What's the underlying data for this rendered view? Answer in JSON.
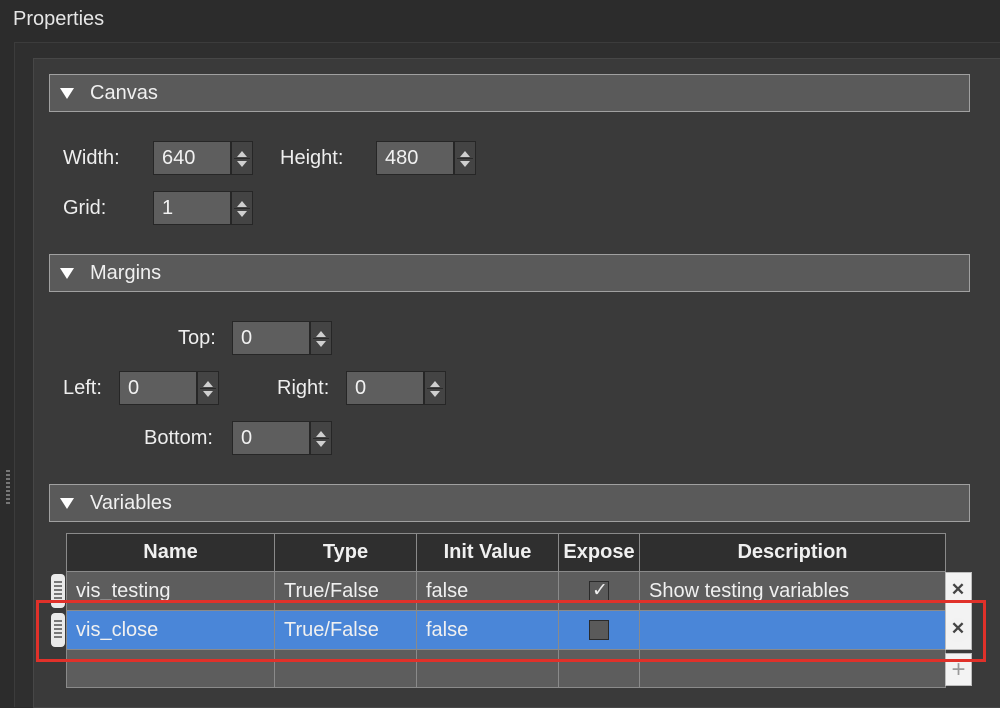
{
  "panel": {
    "title": "Properties"
  },
  "canvas": {
    "header": "Canvas",
    "width_label": "Width:",
    "width_value": "640",
    "height_label": "Height:",
    "height_value": "480",
    "grid_label": "Grid:",
    "grid_value": "1"
  },
  "margins": {
    "header": "Margins",
    "top_label": "Top:",
    "top_value": "0",
    "left_label": "Left:",
    "left_value": "0",
    "right_label": "Right:",
    "right_value": "0",
    "bottom_label": "Bottom:",
    "bottom_value": "0"
  },
  "variables": {
    "header": "Variables",
    "columns": [
      "Name",
      "Type",
      "Init Value",
      "Expose",
      "Description"
    ],
    "rows": [
      {
        "name": "vis_testing",
        "type": "True/False",
        "init": "false",
        "expose": true,
        "description": "Show testing variables"
      },
      {
        "name": "vis_close",
        "type": "True/False",
        "init": "false",
        "expose": false,
        "description": ""
      }
    ],
    "remove_icon": "x-circle-icon",
    "add_icon": "plus-icon"
  },
  "colors": {
    "selection": "#4a86d8",
    "highlight": "#e0312a"
  }
}
